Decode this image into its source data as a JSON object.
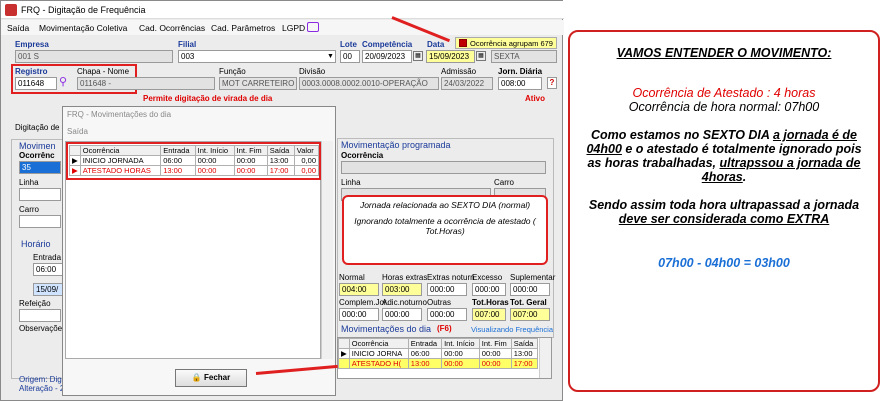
{
  "window": {
    "title": "FRQ - Digitação de Frequência"
  },
  "menu": [
    "Saída",
    "Movimentação Coletiva",
    "Cad. Ocorrências",
    "Cad. Parâmetros",
    "LGPD"
  ],
  "header": {
    "empresa_label": "Empresa",
    "empresa_value": "001 S",
    "filial_label": "Filial",
    "filial_value": "003",
    "lote_label": "Lote",
    "lote_value": "00",
    "competencia_label": "Competência",
    "competencia_value": "20/09/2023",
    "data_label": "Data",
    "data_value": "15/09/2023",
    "weekday": "SEXTA",
    "ocorrencia_agrupam": "Ocorrência agrupam 679",
    "registro_label": "Registro",
    "registro_value": "011648",
    "chapa_label": "Chapa - Nome",
    "chapa_value": "011648 -",
    "funcao_label": "Função",
    "funcao_value": "MOT CARRETEIRO",
    "divisao_label": "Divisão",
    "divisao_value": "0003.0008.0002.0010-OPERAÇÃO",
    "admissao_label": "Admissão",
    "admissao_value": "24/03/2022",
    "jornada_label": "Jorn. Diária",
    "jornada_value": "008:00",
    "permite_msg": "Permite digitação de virada de dia",
    "status": "Ativo",
    "digitacao_label": "Digitação de"
  },
  "left_panel": {
    "movimento_label": "Movimen",
    "ocorrencia_label": "Ocorrênc",
    "ocorrencia_value": "35",
    "linha_label": "Linha",
    "carro_label": "Carro",
    "horario_label": "Horário",
    "entrada_label": "Entrada",
    "entrada_value": "06:00",
    "date_value": "15/09/",
    "refeicao_label": "Refeição",
    "observacoes_label": "Observações",
    "origem": "Origem: Digit",
    "alteracao": "Alteração - 2"
  },
  "dialog": {
    "title": "FRQ - Movimentações do dia",
    "menu": "Saída",
    "columns": [
      "Ocorrência",
      "Entrada",
      "Int. Início",
      "Int. Fim",
      "Saída",
      "Valor"
    ],
    "rows": [
      [
        "INICIO JORNADA",
        "06:00",
        "00:00",
        "00:00",
        "13:00",
        "0,00"
      ],
      [
        "ATESTADO HORAS",
        "13:00",
        "00:00",
        "00:00",
        "17:00",
        "0,00"
      ]
    ],
    "close_label": "Fechar"
  },
  "right_panel": {
    "programada_label": "Movimentação programada",
    "ocorrencia_label": "Ocorrência",
    "linha_label": "Linha",
    "carro_label": "Carro",
    "totals_labels": [
      "Normal",
      "Horas extras",
      "Extras noturn",
      "Excesso",
      "Suplementar"
    ],
    "totals_values": [
      "004:00",
      "003:00",
      "000:00",
      "000:00",
      "000:00"
    ],
    "totals2_labels": [
      "Complem.Jor.",
      "Adic.noturno",
      "Outras",
      "Tot.Horas",
      "Tot. Geral"
    ],
    "totals2_values": [
      "000:00",
      "000:00",
      "000:00",
      "007:00",
      "007:00"
    ],
    "movs_label": "Movimentações do dia",
    "movs_key": "(F6)",
    "visualizando": "Visualizando Frequência",
    "columns": [
      "Ocorrência",
      "Entrada",
      "Int. Início",
      "Int. Fim",
      "Saída"
    ],
    "rows": [
      [
        "INICIO JORNA",
        "06:00",
        "00:00",
        "00:00",
        "13:00"
      ],
      [
        "ATESTADO H(",
        "13:00",
        "00:00",
        "00:00",
        "17:00"
      ]
    ]
  },
  "bubble": {
    "line1": "Jornada relacionada ao SEXTO DIA (normal)",
    "line2": "Ignorando totalmente a ocorrência de atestado ( Tot.Horas)"
  },
  "explanation": {
    "heading": "VAMOS ENTENDER O MOVIMENTO:",
    "red_line": "Ocorrência de Atestado : 4 horas",
    "line2": "Ocorrência de hora normal: 07h00",
    "p1a": "Como estamos no SEXTO DIA ",
    "p1b": "a jornada é de 04h00",
    "p1c": " e o atestado é totalmente ignorado pois as horas trabalhadas, ",
    "p1d": "ultrapssou a jornada de 4horas",
    "p1e": ".",
    "p2a": "Sendo assim toda hora ultrapassad a jornada ",
    "p2b": "deve ser considerada como EXTRA",
    "formula": "07h00 - 04h00 = 03h00"
  },
  "colors": {
    "accent_red": "#e00000",
    "blue": "#1a6fd6",
    "yellow": "#ffff99"
  }
}
